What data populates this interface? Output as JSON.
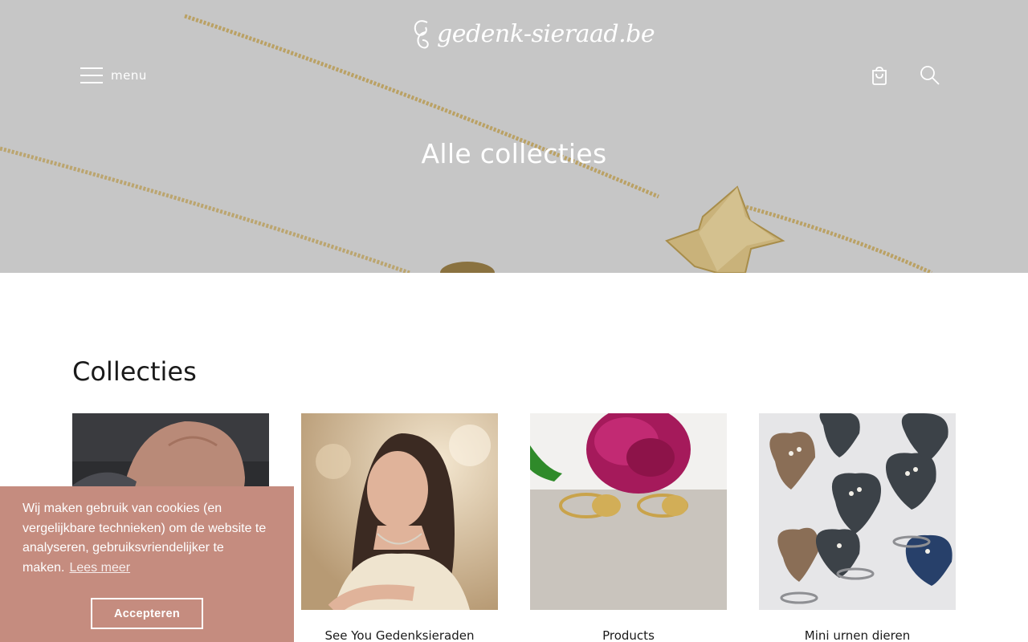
{
  "header": {
    "logo_text": "gedenk-sieraad.be",
    "menu_label": "menu",
    "cart_icon": "shopping-bag-icon",
    "search_icon": "search-icon"
  },
  "hero": {
    "title": "Alle collecties",
    "overlay_color": "#c6c6c6",
    "image_subject": "gold chain necklaces with star pendant"
  },
  "main": {
    "section_title": "Collecties",
    "collections": [
      {
        "label": "",
        "image_subject": "close-up of hand"
      },
      {
        "label": "See You Gedenksieraden",
        "image_subject": "woman wearing jewelry"
      },
      {
        "label": "Products",
        "image_subject": "gold fingerprint rings with peony"
      },
      {
        "label": "Mini urnen dieren",
        "image_subject": "heart-shaped pet urns with paw prints"
      }
    ]
  },
  "cookie_banner": {
    "message": "Wij maken gebruik van cookies (en vergelijkbare technieken) om de website te analyseren, gebruiksvriendelijker te maken.",
    "link_label": "Lees meer",
    "accept_label": "Accepteren",
    "background_color": "#c58c7f"
  }
}
